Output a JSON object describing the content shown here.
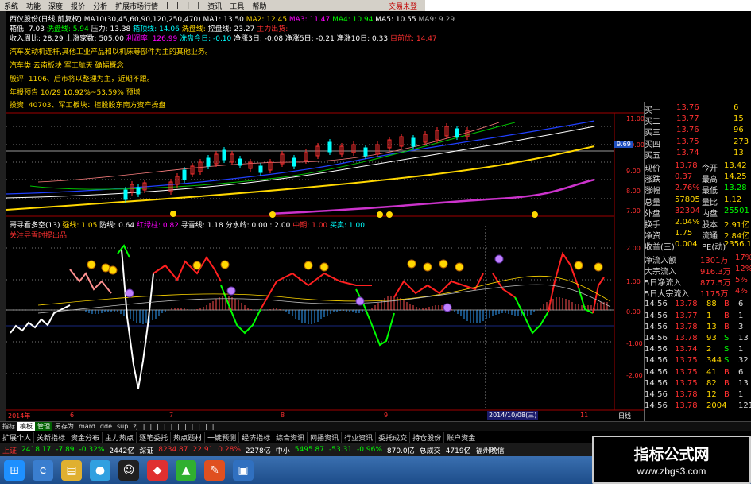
{
  "menubar": {
    "items": [
      "系统",
      "功能",
      "深度",
      "报价",
      "分析",
      "扩展市场行情",
      "|",
      "|",
      "|",
      "|",
      "资讯",
      "工具",
      "帮助"
    ],
    "brand": "交易未登"
  },
  "header": {
    "title": "西仪股份(日线,前复权)",
    "ma_params": "MA10(30,45,60,90,120,250,470)",
    "ma1": "MA1: 13.50",
    "ma2": "MA2: 12.45",
    "ma3": "MA3: 11.47",
    "ma4": "MA4: 10.94",
    "ma5": "MA5: 10.55",
    "ma9": "MA9: 9.29",
    "row2": [
      "箱低: 7.03",
      "洗盘线: 5.94",
      "压力: 13.38",
      "箱顶线: 14.06",
      "洗盘线:",
      "控盘线: 23.27",
      "主力出货:"
    ],
    "row3": [
      "收入周比: 28.29",
      "上涨家数: 505.00",
      "利润率: 126.99",
      "洗盘今日: -0.10",
      "净涨3日: -0.08",
      "净涨5日: -0.21",
      "净涨10日: 0.33",
      "目前优: 14.47"
    ]
  },
  "info": {
    "l1": "汽车发动机连杆,其他工业产品和以机床等部件为主的其他业务。",
    "l2": "汽车类 云南板块 军工航天 确幅概念",
    "l3": "股评: 1106、后市将以整理为主，近期不跟。",
    "l4": "年报预告",
    "l5": "年报预告 10/29 10.92%~53.59% 预增",
    "l6": "投资: 40703、军工板块：控股股东南方资产操盘"
  },
  "indicator": {
    "title": "哥寻看多空(13)",
    "strong": "强线: 1.05",
    "defense": "防线: 0.64",
    "red": "红绿柱: 0.82",
    "seek": "寻雪线: 1.18",
    "divide": "分水岭: 0.00 : 2.00",
    "mid": "中期: 1.00",
    "buy": "买卖: 1.00",
    "alert": "关注寻雪时提出品"
  },
  "price_axis": {
    "main": [
      "11.00",
      "10.00",
      "9.00",
      "8.00",
      "7.00"
    ],
    "marker": "9.69",
    "ind": [
      "2.00",
      "1.00",
      "0.00",
      "-1.00",
      "-2.00"
    ]
  },
  "dates": [
    "2014年",
    "6",
    "7",
    "8",
    "9",
    "2014/10/08(三)",
    "11",
    "日线"
  ],
  "quotes": {
    "buy_labels": [
      "买一",
      "买二",
      "买三",
      "买四",
      "买五"
    ],
    "buy_prices": [
      "13.76",
      "13.77",
      "13.76",
      "13.75",
      "13.74"
    ],
    "buy_vols": [
      "6",
      "15",
      "96",
      "273",
      "13"
    ],
    "stats": [
      {
        "k": "现价",
        "v": "13.78",
        "k2": "今开",
        "v2": "13.42"
      },
      {
        "k": "涨跌",
        "v": "0.37",
        "k2": "最高",
        "v2": "14.25"
      },
      {
        "k": "涨幅",
        "v": "2.76%",
        "k2": "最低",
        "v2": "13.28"
      },
      {
        "k": "总量",
        "v": "57805",
        "k2": "量比",
        "v2": "1.12"
      },
      {
        "k": "外盘",
        "v": "32304",
        "k2": "内盘",
        "v2": "25501"
      },
      {
        "k": "换手",
        "v": "2.04%",
        "k2": "股本",
        "v2": "2.91亿"
      },
      {
        "k": "净资",
        "v": "1.75",
        "k2": "流通",
        "v2": "2.84亿"
      },
      {
        "k": "收益(三)",
        "v": "0.004",
        "k2": "PE(动)",
        "v2": "2356.1"
      }
    ],
    "flows": [
      {
        "k": "净流入额",
        "v": "1301万",
        "p": "17%"
      },
      {
        "k": "大宗流入",
        "v": "916.3万",
        "p": "12%"
      },
      {
        "k": "5日净流入",
        "v": "877.5万",
        "p": "5%"
      },
      {
        "k": "5日大宗流入",
        "v": "1175万",
        "p": "4%"
      }
    ],
    "ticks": [
      {
        "t": "14:56",
        "p": "13.78",
        "v": "88",
        "s": "B",
        "n": "6"
      },
      {
        "t": "14:56",
        "p": "13.77",
        "v": "1",
        "s": "B",
        "n": "1"
      },
      {
        "t": "14:56",
        "p": "13.78",
        "v": "13",
        "s": "B",
        "n": "3"
      },
      {
        "t": "14:56",
        "p": "13.78",
        "v": "93",
        "s": "S",
        "n": "13"
      },
      {
        "t": "14:56",
        "p": "13.74",
        "v": "2",
        "s": "S",
        "n": "1"
      },
      {
        "t": "14:56",
        "p": "13.75",
        "v": "344",
        "s": "S",
        "n": "32"
      },
      {
        "t": "14:56",
        "p": "13.75",
        "v": "41",
        "s": "B",
        "n": "6"
      },
      {
        "t": "14:56",
        "p": "13.75",
        "v": "82",
        "s": "B",
        "n": "13"
      },
      {
        "t": "14:56",
        "p": "13.78",
        "v": "12",
        "s": "B",
        "n": "1"
      },
      {
        "t": "14:56",
        "p": "13.78",
        "v": "2004",
        "s": "",
        "n": "121"
      }
    ]
  },
  "tabbar": [
    "指标",
    "模板",
    "管理",
    "另存为",
    "mard",
    "dde",
    "sup",
    "zj",
    "|",
    "|",
    "|",
    "|",
    "|",
    "|",
    "|",
    "|",
    "|",
    "|",
    "|"
  ],
  "funcbar": [
    "扩展个人",
    "关新指标",
    "资金分布",
    "主力热点",
    "逐笔委托",
    "热点题材",
    "一键预测",
    "经济指标",
    "综合资讯",
    "网播资讯",
    "行业资讯",
    "委托成交",
    "持仓股份",
    "账户资金"
  ],
  "statusbar": {
    "sh": "上证",
    "sh_val": "2418.17",
    "sh_chg": "-7.89",
    "sh_pct": "-0.32%",
    "sh_amt": "2442亿",
    "sz": "深证",
    "sz_val": "8234.87",
    "sz_chg": "22.91",
    "sz_pct": "0.28%",
    "sz_amt": "2278亿",
    "zx": "中小",
    "zx_val": "5495.87",
    "zx_chg": "-53.31",
    "zx_pct": "-0.96%",
    "zx_amt": "870.0亿",
    "total_lbl": "总成交",
    "total": "4719亿",
    "label2": "福州晚信"
  },
  "watermark": {
    "title": "指标公式网",
    "url": "www.zbgs3.com"
  },
  "colors": {
    "up": "#ff3030",
    "down": "#00ff00",
    "ma_yellow": "#ffd700",
    "ma_white": "#ffffff",
    "ma_magenta": "#cc33cc"
  }
}
